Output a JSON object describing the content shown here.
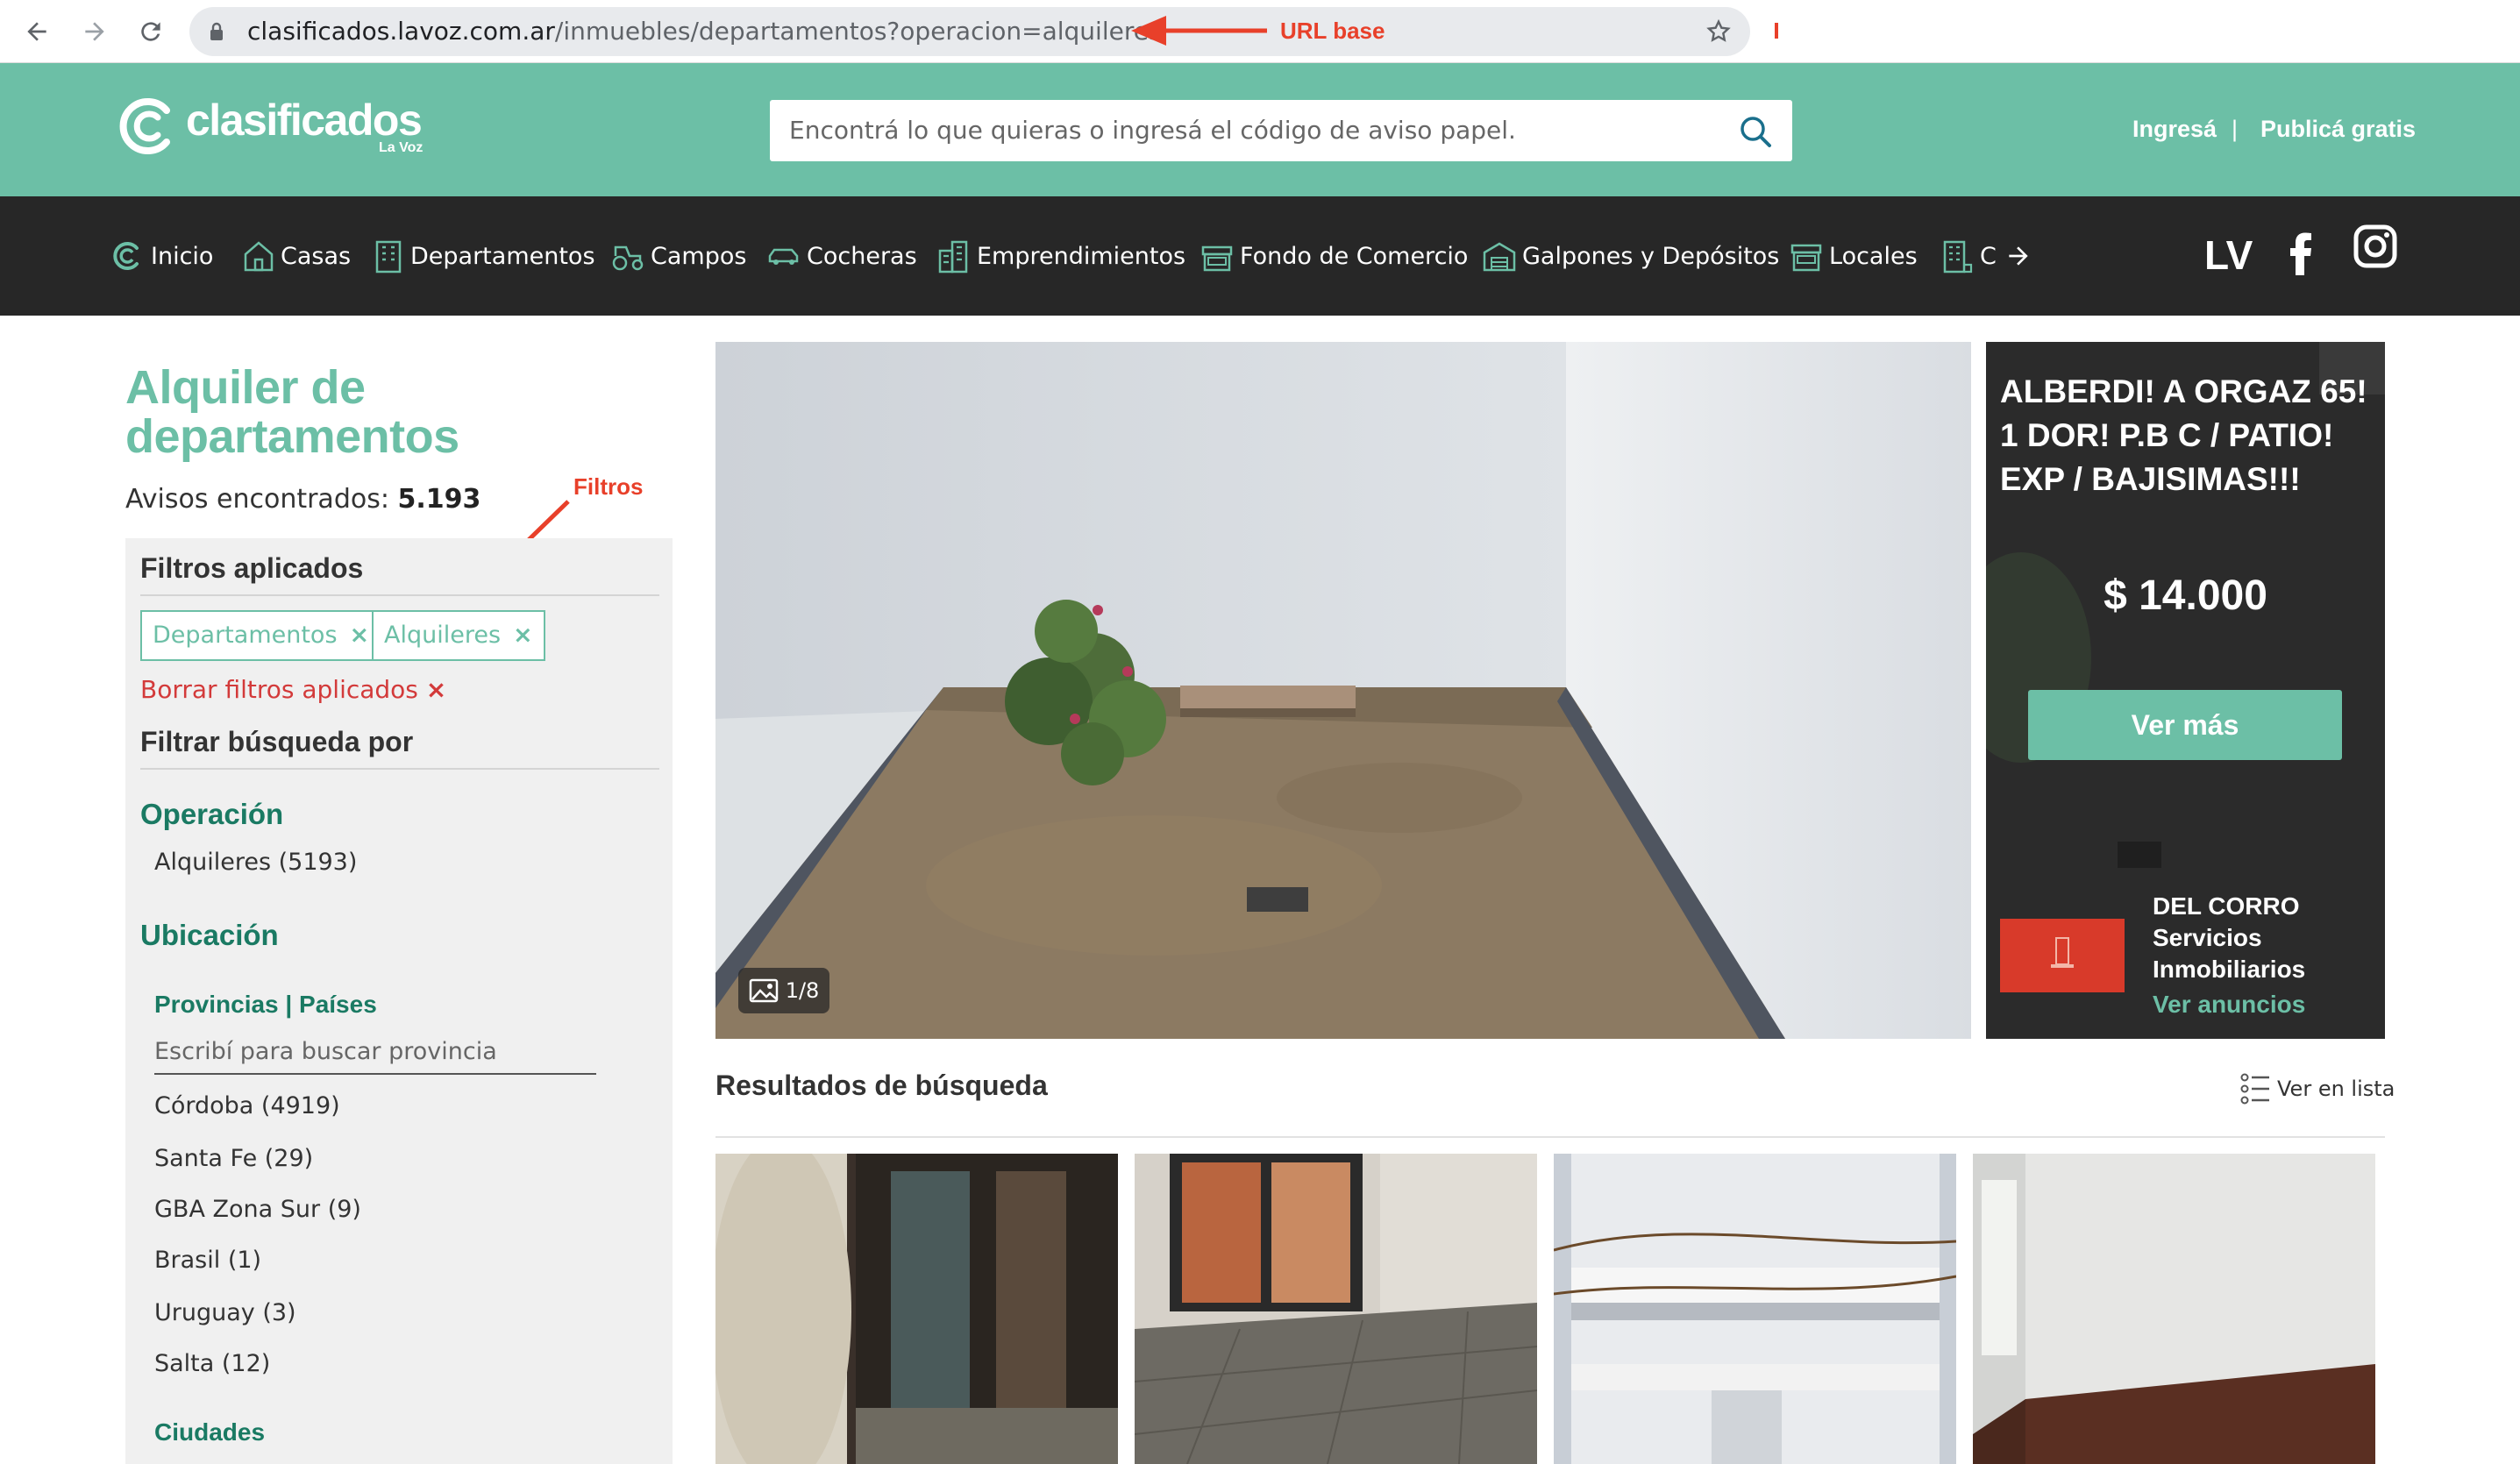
{
  "browser": {
    "url_host": "clasificados.lavoz.com.ar",
    "url_path": "/inmuebles/departamentos?operacion=alquileres"
  },
  "header": {
    "logo": "clasificados",
    "logo_sub": "La Voz",
    "search_placeholder": "Encontrá lo que quieras o ingresá el código de aviso papel.",
    "login": "Ingresá",
    "separator": "|",
    "publish": "Publicá gratis"
  },
  "categories": [
    {
      "label": "Inicio",
      "icon": "home-logo-icon"
    },
    {
      "label": "Casas",
      "icon": "house-icon"
    },
    {
      "label": "Departamentos",
      "icon": "building-icon"
    },
    {
      "label": "Campos",
      "icon": "tractor-icon"
    },
    {
      "label": "Cocheras",
      "icon": "car-icon"
    },
    {
      "label": "Emprendimientos",
      "icon": "buildings-icon"
    },
    {
      "label": "Fondo de Comercio",
      "icon": "store-icon"
    },
    {
      "label": "Galpones y Depósitos",
      "icon": "warehouse-icon"
    },
    {
      "label": "Locales",
      "icon": "shop-icon"
    },
    {
      "label": "C",
      "icon": "office-icon"
    }
  ],
  "social": {
    "lv": "LV"
  },
  "sidebar": {
    "title": "Alquiler de departamentos",
    "count_label": "Avisos encontrados: ",
    "count_value": "5.193",
    "applied_heading": "Filtros aplicados",
    "chips": [
      "Departamentos",
      "Alquileres"
    ],
    "chip_remove": "×",
    "clear_label": "Borrar filtros aplicados",
    "clear_x": "×",
    "filter_heading": "Filtrar búsqueda por",
    "operation_heading": "Operación",
    "operation_items": [
      "Alquileres (5193)"
    ],
    "location_heading": "Ubicación",
    "provinces_heading": "Provincias | Países",
    "province_placeholder": "Escribí para buscar provincia",
    "provinces": [
      "Córdoba (4919)",
      "Santa Fe (29)",
      "GBA Zona Sur (9)",
      "Brasil (1)",
      "Uruguay (3)",
      "Salta (12)"
    ],
    "cities_heading": "Ciudades"
  },
  "hero": {
    "counter": "1/8"
  },
  "featured": {
    "title": "ALBERDI! A ORGAZ 65! 1 DOR! P.B C / PATIO! EXP / BAJISIMAS!!!",
    "price": "$ 14.000",
    "button": "Ver más",
    "agency_line1": "DEL CORRO",
    "agency_line2": "Servicios",
    "agency_line3": "Inmobiliarios",
    "agency_link": "Ver anuncios"
  },
  "results": {
    "title": "Resultados de búsqueda",
    "view_list": "Ver en lista"
  },
  "annotations": {
    "url": "URL base",
    "filters": "Filtros",
    "color": "#e8402a"
  },
  "colors": {
    "brand": "#6cbfa6",
    "nav": "#272727",
    "heading_green": "#1a7a63",
    "clear_red": "#d33a3a"
  }
}
